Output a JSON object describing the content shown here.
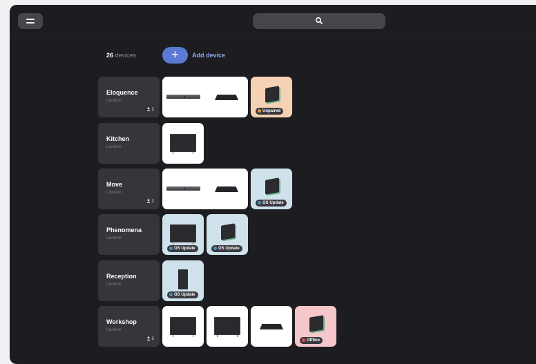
{
  "header": {
    "search_icon": "search-icon",
    "menu_icon": "menu-icon"
  },
  "summary": {
    "count": "26",
    "count_label": "devices"
  },
  "add": {
    "label": "Add device",
    "icon": "+"
  },
  "colors": {
    "accent": "#5a7ad4",
    "unpaired": "#e8912f",
    "os_update": "#4a90b8",
    "offline": "#e0555c"
  },
  "rooms": [
    {
      "name": "Eloquence",
      "city": "London",
      "users": "2"
    },
    {
      "name": "Kitchen",
      "city": "London"
    },
    {
      "name": "Move",
      "city": "London",
      "users": "2"
    },
    {
      "name": "Phenomena",
      "city": "London"
    },
    {
      "name": "Reception",
      "city": "London"
    },
    {
      "name": "Workshop",
      "city": "London",
      "users": "2"
    }
  ],
  "status": {
    "unpaired": "Unpaired",
    "os_update": "OS Update",
    "offline": "Offline"
  }
}
